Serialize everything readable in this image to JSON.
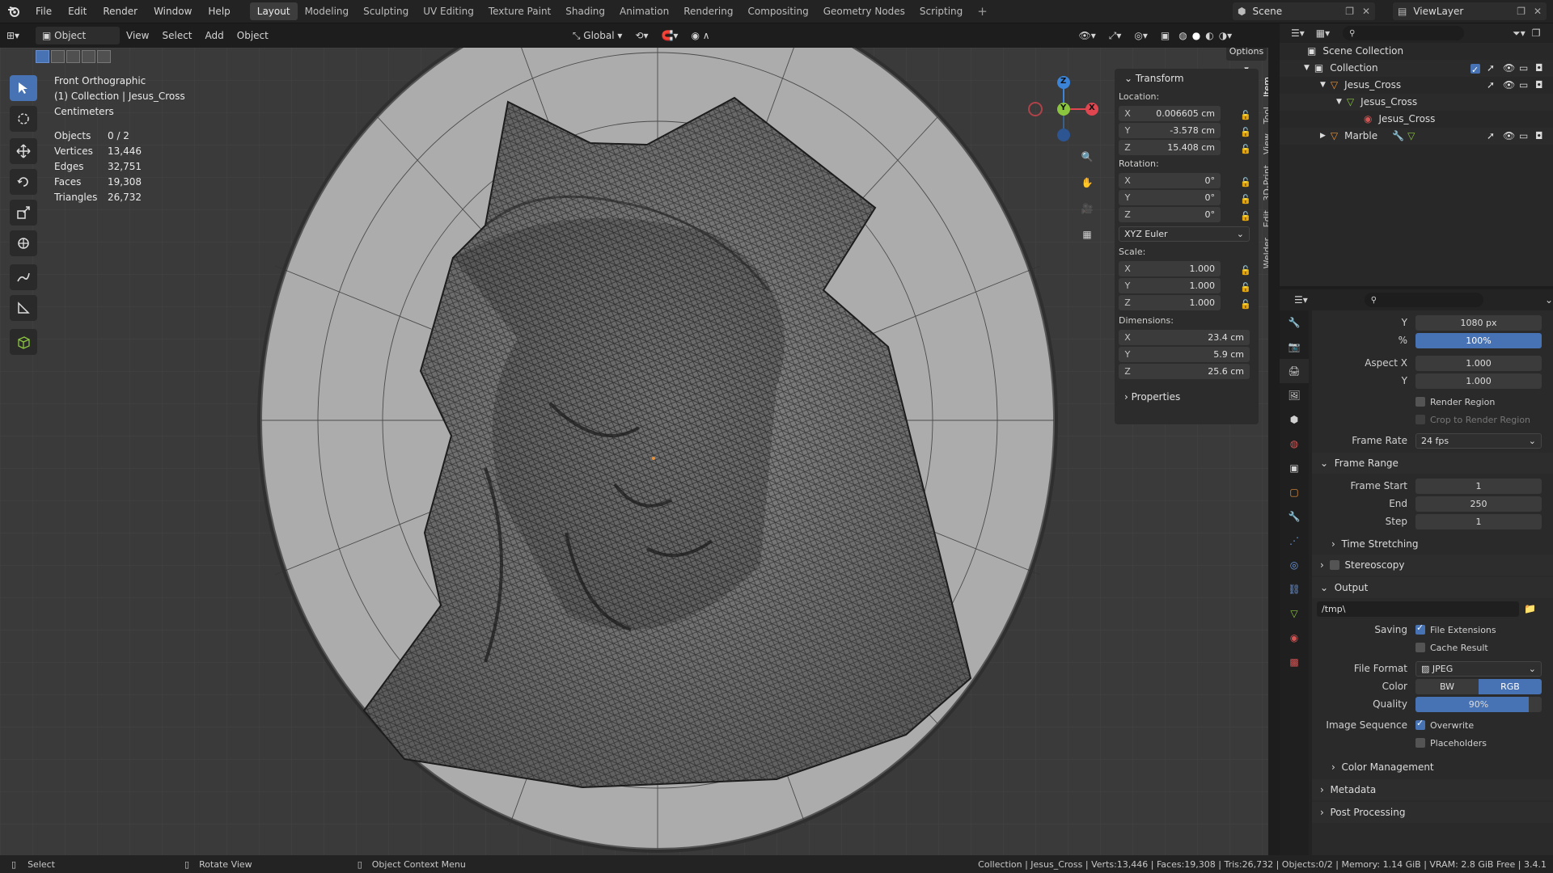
{
  "topbar": {
    "menus": [
      "File",
      "Edit",
      "Render",
      "Window",
      "Help"
    ],
    "workspaces": [
      "Layout",
      "Modeling",
      "Sculpting",
      "UV Editing",
      "Texture Paint",
      "Shading",
      "Animation",
      "Rendering",
      "Compositing",
      "Geometry Nodes",
      "Scripting"
    ],
    "active_workspace": "Layout",
    "scene": "Scene",
    "view_layer": "ViewLayer"
  },
  "viewport_header": {
    "mode": "Object Mode",
    "view": "View",
    "select": "Select",
    "add": "Add",
    "object": "Object",
    "orientation": "Global",
    "options": "Options"
  },
  "viewport": {
    "view_name": "Front Orthographic",
    "collection_line": "(1) Collection | Jesus_Cross",
    "units": "Centimeters",
    "stats": [
      {
        "label": "Objects",
        "value": "0 / 2"
      },
      {
        "label": "Vertices",
        "value": "13,446"
      },
      {
        "label": "Edges",
        "value": "32,751"
      },
      {
        "label": "Faces",
        "value": "19,308"
      },
      {
        "label": "Triangles",
        "value": "26,732"
      }
    ],
    "gizmo": {
      "z": "Z",
      "y": "Y",
      "x": "X"
    }
  },
  "npanel": {
    "transform": "Transform",
    "location_label": "Location:",
    "location": {
      "x": "0.006605 cm",
      "y": "-3.578 cm",
      "z": "15.408 cm"
    },
    "rotation_label": "Rotation:",
    "rotation": {
      "x": "0°",
      "y": "0°",
      "z": "0°"
    },
    "rotation_mode": "XYZ Euler",
    "scale_label": "Scale:",
    "scale": {
      "x": "1.000",
      "y": "1.000",
      "z": "1.000"
    },
    "dimensions_label": "Dimensions:",
    "dimensions": {
      "x": "23.4 cm",
      "y": "5.9 cm",
      "z": "25.6 cm"
    },
    "properties": "Properties",
    "axis": {
      "x": "X",
      "y": "Y",
      "z": "Z"
    },
    "tabs": [
      "Item",
      "Tool",
      "View",
      "3D-Print",
      "Edit",
      "Welder"
    ]
  },
  "outliner": {
    "scene_collection": "Scene Collection",
    "collection": "Collection",
    "object1": "Jesus_Cross",
    "mesh": "Jesus_Cross",
    "material": "Jesus_Cross",
    "object2": "Marble"
  },
  "properties": {
    "res_y_label": "Y",
    "res_y": "1080 px",
    "percent_label": "%",
    "percent": "100%",
    "aspect_x_label": "Aspect X",
    "aspect_x": "1.000",
    "aspect_y_label": "Y",
    "aspect_y": "1.000",
    "render_region": "Render Region",
    "crop_region": "Crop to Render Region",
    "frame_rate_label": "Frame Rate",
    "frame_rate": "24 fps",
    "frame_range": "Frame Range",
    "frame_start_label": "Frame Start",
    "frame_start": "1",
    "end_label": "End",
    "end": "250",
    "step_label": "Step",
    "step": "1",
    "time_stretching": "Time Stretching",
    "stereoscopy": "Stereoscopy",
    "output": "Output",
    "output_path": "/tmp\\",
    "saving_label": "Saving",
    "file_extensions": "File Extensions",
    "cache_result": "Cache Result",
    "file_format_label": "File Format",
    "file_format": "JPEG",
    "color_label": "Color",
    "color_bw": "BW",
    "color_rgb": "RGB",
    "quality_label": "Quality",
    "quality": "90%",
    "image_sequence_label": "Image Sequence",
    "overwrite": "Overwrite",
    "placeholders": "Placeholders",
    "color_management": "Color Management",
    "metadata": "Metadata",
    "post_processing": "Post Processing"
  },
  "statusbar": {
    "select": "Select",
    "rotate": "Rotate View",
    "context": "Object Context Menu",
    "info": "Collection | Jesus_Cross | Verts:13,446 | Faces:19,308 | Tris:26,732 | Objects:0/2 | Memory: 1.14 GiB | VRAM: 2.8 GiB Free | 3.4.1"
  },
  "colors": {
    "accent": "#4772b3",
    "axis_x": "#e0464f",
    "axis_y": "#8bc53f",
    "axis_z": "#3b84d8",
    "object_orange": "#e8923a"
  }
}
